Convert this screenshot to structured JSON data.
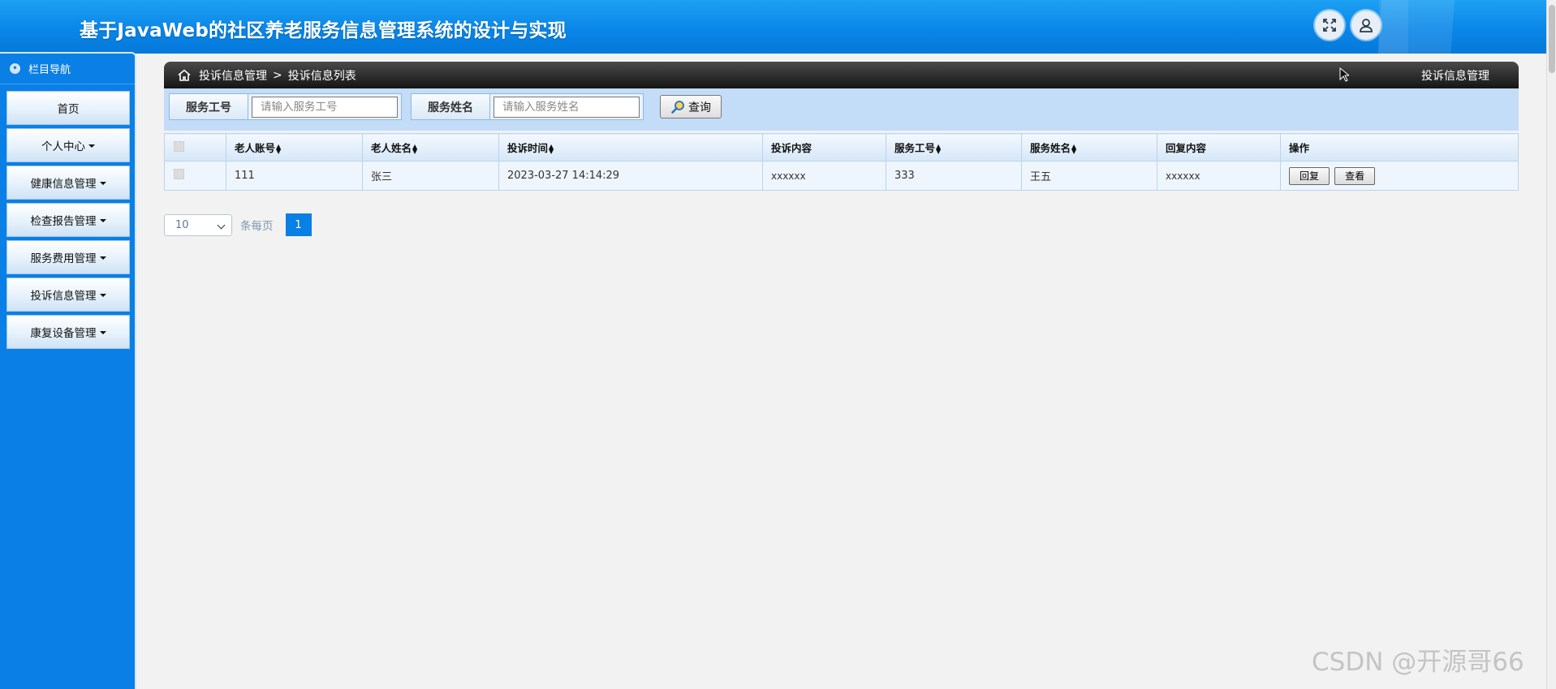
{
  "header": {
    "title": "基于JavaWeb的社区养老服务信息管理系统的设计与实现",
    "fullscreen_icon": "expand-icon",
    "user_icon": "user-icon"
  },
  "sidebar": {
    "heading": "栏目导航",
    "items": [
      {
        "label": "首页",
        "dropdown": false
      },
      {
        "label": "个人中心",
        "dropdown": true
      },
      {
        "label": "健康信息管理",
        "dropdown": true
      },
      {
        "label": "检查报告管理",
        "dropdown": true
      },
      {
        "label": "服务费用管理",
        "dropdown": true
      },
      {
        "label": "投诉信息管理",
        "dropdown": true
      },
      {
        "label": "康复设备管理",
        "dropdown": true
      }
    ]
  },
  "breadcrumb": {
    "parent": "投诉信息管理",
    "separator": ">",
    "current": "投诉信息列表",
    "right_title": "投诉信息管理"
  },
  "search": {
    "field1_label": "服务工号",
    "field1_placeholder": "请输入服务工号",
    "field2_label": "服务姓名",
    "field2_placeholder": "请输入服务姓名",
    "query_label": "查询"
  },
  "table": {
    "columns": [
      "老人账号",
      "老人姓名",
      "投诉时间",
      "投诉内容",
      "服务工号",
      "服务姓名",
      "回复内容",
      "操作"
    ],
    "rows": [
      {
        "account": "111",
        "name": "张三",
        "time": "2023-03-27 14:14:29",
        "content": "xxxxxx",
        "staff_id": "333",
        "staff_name": "王五",
        "reply": "xxxxxx",
        "actions": [
          "回复",
          "查看"
        ]
      }
    ]
  },
  "pager": {
    "page_size": "10",
    "per_page_label": "条每页",
    "current_page": "1"
  },
  "watermark": "CSDN @开源哥66",
  "colors": {
    "primary": "#0a7fe6",
    "header": "#1da1f2",
    "crumb_bar": "#1f1f1f",
    "search_bg": "#c3dcf8"
  }
}
